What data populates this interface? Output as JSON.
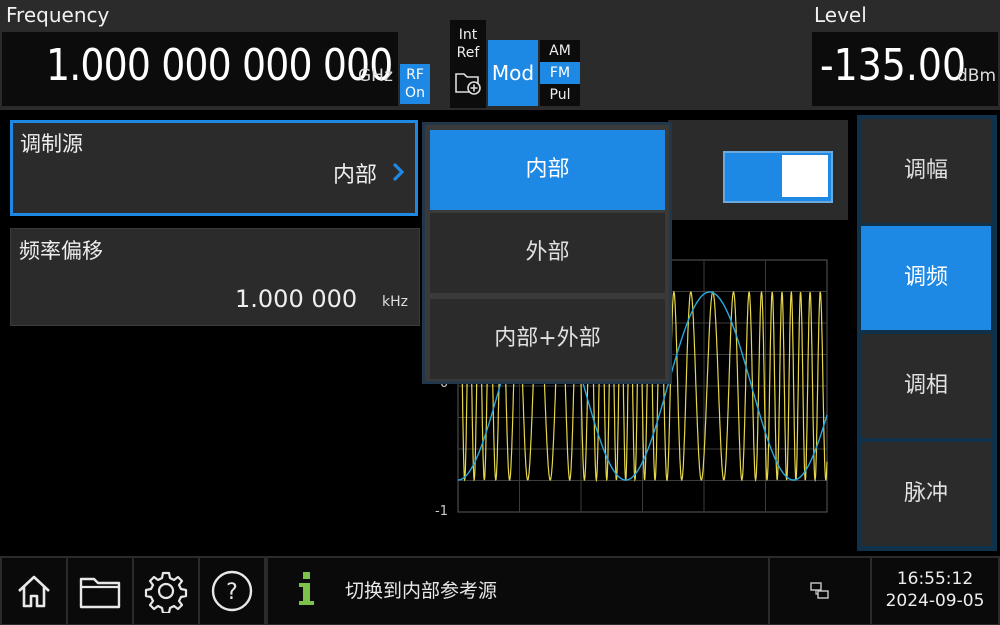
{
  "header": {
    "frequency_label": "Frequency",
    "frequency_value": "1.000 000 000 000",
    "frequency_unit": "GHz",
    "rf_state": [
      "RF",
      "On"
    ],
    "ref_label": [
      "Int",
      "Ref"
    ],
    "mod_label": "Mod",
    "mod_types": [
      "AM",
      "FM",
      "Pul"
    ],
    "level_label": "Level",
    "level_value": "-135.00",
    "level_unit": "dBm"
  },
  "params": {
    "mod_source": {
      "title": "调制源",
      "value": "内部"
    },
    "freq_offset": {
      "title": "频率偏移",
      "value": "1.000 000",
      "unit": "kHz"
    }
  },
  "dropdown": {
    "options": [
      "内部",
      "外部",
      "内部+外部"
    ]
  },
  "chart": {
    "y_ticks": [
      "0",
      "-1"
    ]
  },
  "chart_data": {
    "type": "line",
    "ylim": [
      -1,
      1
    ],
    "series": [
      {
        "color": "#e6d64a",
        "kind": "fm-carrier"
      },
      {
        "color": "#2aa8e0",
        "kind": "modulating-sine",
        "cycles": 2.2
      }
    ]
  },
  "side_menu": {
    "items": [
      "调幅",
      "调频",
      "调相",
      "脉冲"
    ]
  },
  "footer": {
    "status_message": "切换到内部参考源",
    "time": "16:55:12",
    "date": "2024-09-05"
  },
  "colors": {
    "accent": "#1e88e5",
    "panel": "#2b2b2b",
    "info_icon": "#7cc24a",
    "carrier": "#e6d64a",
    "modulating": "#2aa8e0"
  }
}
